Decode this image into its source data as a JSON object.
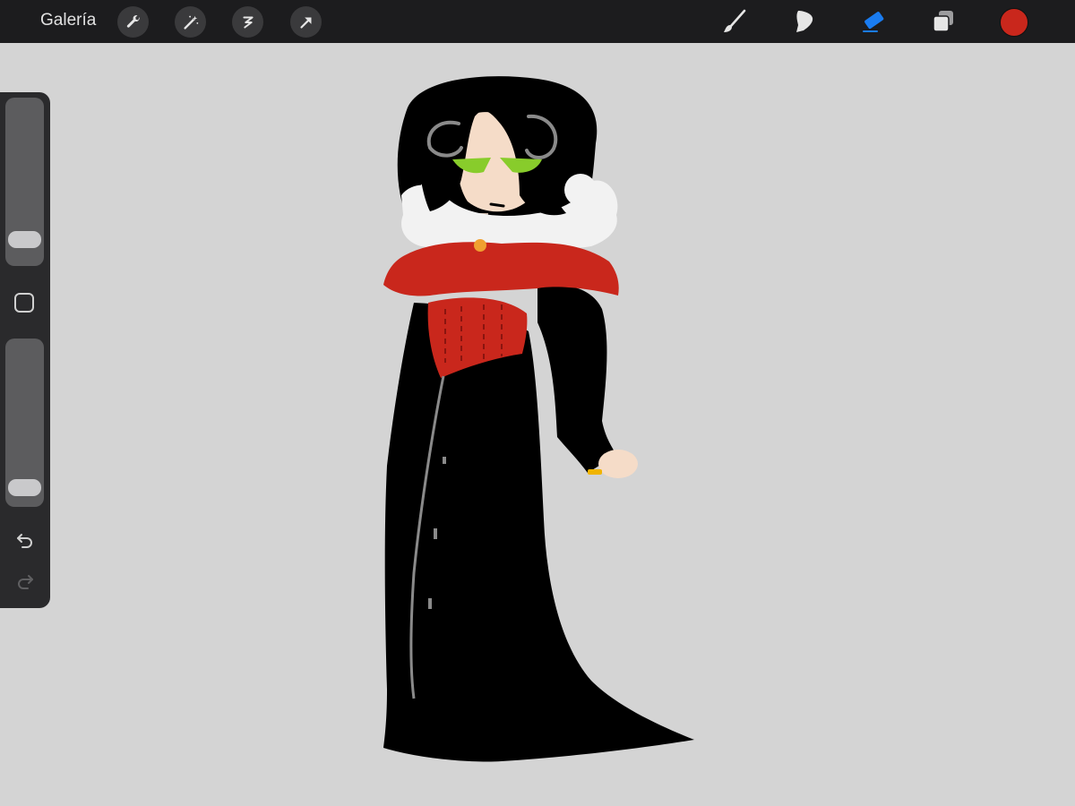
{
  "topbar": {
    "gallery_label": "Galería",
    "left_tools": [
      "wrench-icon",
      "magic-wand-icon",
      "selection-icon",
      "transform-arrow-icon"
    ],
    "right_tools": [
      "brush-icon",
      "smudge-icon",
      "eraser-icon",
      "layers-icon"
    ],
    "active_tool": "eraser",
    "current_color": "#c9271c",
    "active_tool_color": "#1a7cf0"
  },
  "sidebar": {
    "brush_size_slider": {
      "value": 0.1
    },
    "opacity_slider": {
      "value": 0.05
    },
    "buttons": [
      "modify-square-icon",
      "undo-icon",
      "redo-icon"
    ]
  },
  "canvas": {
    "background": "#d4d4d4",
    "artwork_subject": "gothic-woman-figure",
    "palette": [
      "#000000",
      "#f2f2f2",
      "#c9271c",
      "#88cc2b",
      "#f5dcc8",
      "#8a8a8a"
    ]
  }
}
